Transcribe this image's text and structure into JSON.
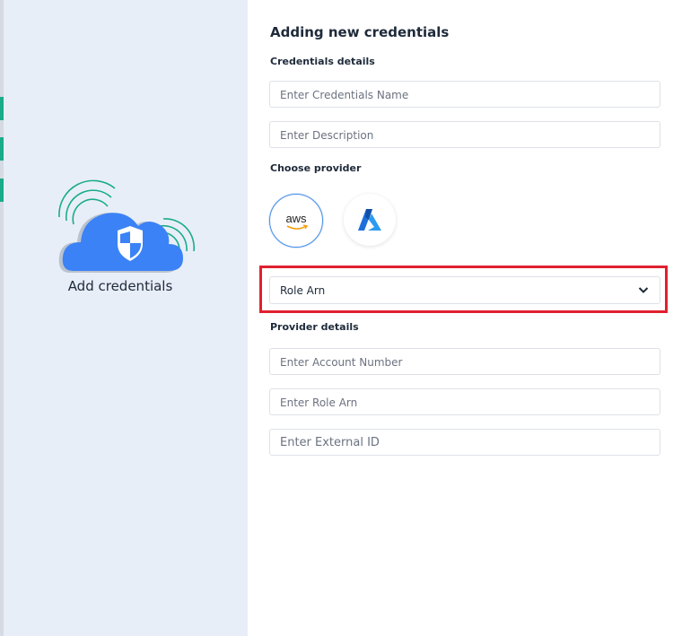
{
  "left_panel": {
    "caption": "Add credentials",
    "illustration_icon": "cloud-shield-icon"
  },
  "form": {
    "title": "Adding new credentials",
    "credentials_section": "Credentials details",
    "name_placeholder": "Enter Credentials Name",
    "description_placeholder": "Enter Description",
    "provider_section": "Choose provider",
    "providers": [
      {
        "label": "aws",
        "icon": "aws-logo-icon",
        "selected": true
      },
      {
        "icon": "azure-logo-icon",
        "selected": false
      }
    ],
    "auth_type": {
      "value": "Role Arn",
      "icon": "chevron-down-icon"
    },
    "provider_details_section": "Provider details",
    "account_number_placeholder": "Enter Account Number",
    "role_arn_placeholder": "Enter Role Arn",
    "external_id_placeholder": "Enter External ID"
  },
  "colors": {
    "left_background": "#e8eef8",
    "accent_blue": "#3b82f6",
    "signal_green": "#1aab8a",
    "highlight_red": "#e0202f"
  }
}
